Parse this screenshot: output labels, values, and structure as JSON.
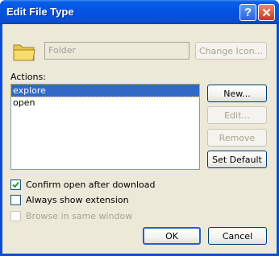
{
  "window": {
    "title": "Edit File Type"
  },
  "file_type": {
    "name_value": "Folder"
  },
  "buttons": {
    "change_icon": "Change Icon...",
    "new": "New...",
    "edit": "Edit...",
    "remove": "Remove",
    "set_default": "Set Default",
    "ok": "OK",
    "cancel": "Cancel"
  },
  "actions": {
    "label": "Actions:",
    "items": [
      {
        "label": "explore",
        "selected": true
      },
      {
        "label": "open",
        "selected": false
      }
    ]
  },
  "options": {
    "confirm_open": {
      "label": "Confirm open after download",
      "checked": true
    },
    "always_show_ext": {
      "label": "Always show extension",
      "checked": false
    },
    "browse_same_window": {
      "label": "Browse in same window",
      "checked": false,
      "disabled": true
    }
  },
  "icons": {
    "folder": "folder-icon",
    "help": "help-icon",
    "close": "close-icon",
    "check": "checkmark-icon"
  },
  "colors": {
    "titlebar": "#0454e4",
    "selection": "#316ac5",
    "dialog_bg": "#ece9d8"
  }
}
